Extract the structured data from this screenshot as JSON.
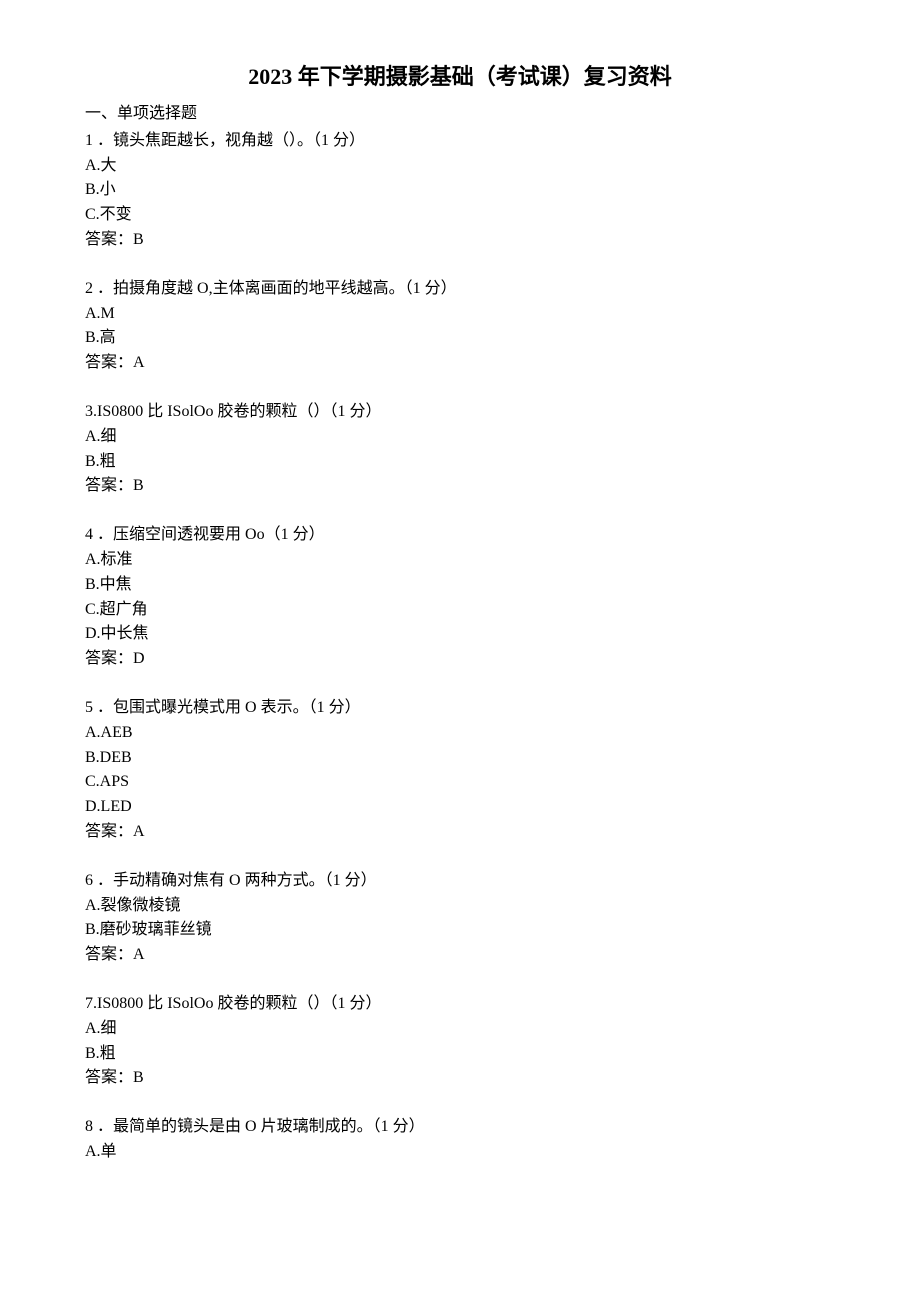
{
  "title": "2023 年下学期摄影基础（考试课）复习资料",
  "section": "一、单项选择题",
  "questions": [
    {
      "num": "1 ．",
      "text": "镜头焦距越长，视角越（）。（1 分）",
      "options": [
        "A.大",
        "B.小",
        "C.不变"
      ],
      "answer": "答案：B"
    },
    {
      "num": "2 ．",
      "text": "拍摄角度越 O,主体离画面的地平线越高。（1 分）",
      "options": [
        "A.M",
        "B.高"
      ],
      "answer": "答案：A"
    },
    {
      "num": "3.",
      "text": "IS0800 比 ISolOo 胶卷的颗粒（）（1 分）",
      "options": [
        "A.细",
        "B.粗"
      ],
      "answer": "答案：B"
    },
    {
      "num": "4 ．",
      "text": "压缩空间透视要用 Oo（1 分）",
      "options": [
        "A.标准",
        "B.中焦",
        "C.超广角",
        "D.中长焦"
      ],
      "answer": "答案：D"
    },
    {
      "num": "5 ．",
      "text": "包围式曝光模式用 O 表示。（1 分）",
      "options": [
        "A.AEB",
        "B.DEB",
        "C.APS",
        "D.LED"
      ],
      "answer": "答案：A"
    },
    {
      "num": "6 ．",
      "text": "手动精确对焦有 O 两种方式。（1 分）",
      "options": [
        "A.裂像微棱镜",
        "B.磨砂玻璃菲丝镜"
      ],
      "answer": "答案：A"
    },
    {
      "num": "7.",
      "text": "IS0800 比 ISolOo 胶卷的颗粒（）（1 分）",
      "options": [
        "A.细",
        "B.粗"
      ],
      "answer": "答案：B"
    },
    {
      "num": "8 ．",
      "text": "最简单的镜头是由 O 片玻璃制成的。（1 分）",
      "options": [
        "A.单"
      ],
      "answer": ""
    }
  ]
}
